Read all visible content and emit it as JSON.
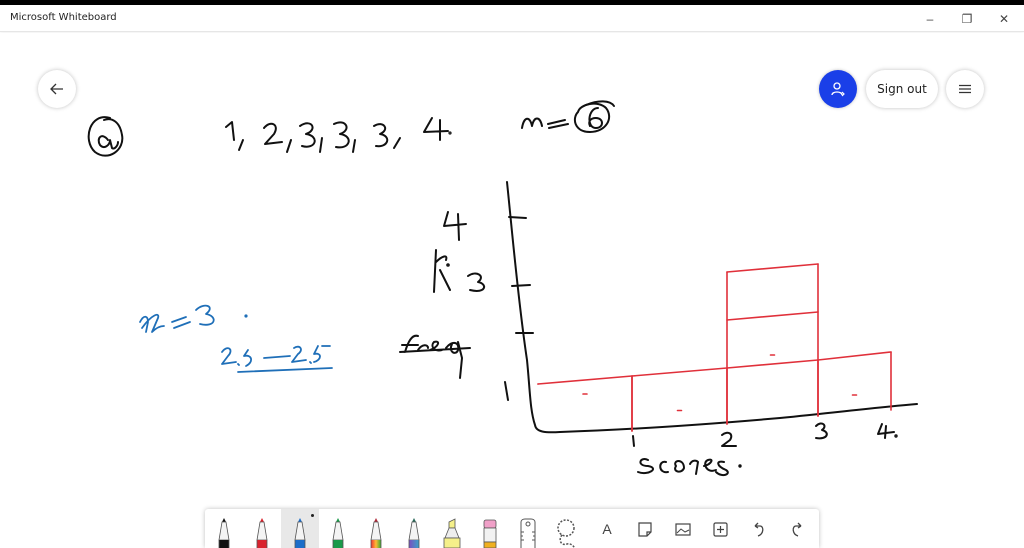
{
  "window": {
    "title": "Microsoft Whiteboard",
    "controls": {
      "minimize": "–",
      "restore": "❐",
      "close": "✕"
    }
  },
  "header": {
    "back_icon": "←",
    "share_icon": "person-add",
    "sign_out_label": "Sign out",
    "menu_icon": "≡",
    "share_color": "#1a3fe8"
  },
  "board": {
    "question_label": "(a)",
    "data_list": "1, 2, 3, 3, 3, 4.",
    "n_label": "n = 6",
    "side_note_1": "x = 3.",
    "side_note_2": "2.5 — 2.5",
    "y_axis_label": "freq / fi",
    "x_axis_label": "scores.",
    "y_ticks": [
      "1",
      "3",
      "4"
    ],
    "x_ticks": [
      "1",
      "2",
      "3",
      "4."
    ],
    "ink_colors": {
      "black": "#111111",
      "red": "#e0303a",
      "blue": "#1f6fb8"
    }
  },
  "chart_data": {
    "type": "bar",
    "title": "",
    "xlabel": "scores.",
    "ylabel": "freq",
    "categories": [
      "1",
      "2",
      "3",
      "4"
    ],
    "values": [
      1,
      1,
      3,
      1
    ],
    "note": "hand-drawn histogram of data 1,2,3,3,3,4 (frequency per score)",
    "ylim": [
      0,
      4
    ]
  },
  "toolbar": {
    "tools": [
      {
        "name": "pen-black",
        "color": "#111111"
      },
      {
        "name": "pen-red",
        "color": "#d9232e"
      },
      {
        "name": "pen-blue",
        "color": "#1c6dc9",
        "selected": true
      },
      {
        "name": "pen-green",
        "color": "#1a9a4a"
      },
      {
        "name": "pen-rainbow",
        "color": "#e0552a"
      },
      {
        "name": "pen-galaxy",
        "color": "#6a5acd"
      },
      {
        "name": "highlighter",
        "color": "#f5f08a"
      },
      {
        "name": "eraser",
        "color": "#f0a0c8"
      },
      {
        "name": "ruler",
        "color": "#555555"
      },
      {
        "name": "lasso",
        "color": "#555555"
      }
    ],
    "text_tool_label": "A",
    "note_icon": "▭",
    "image_icon": "▣",
    "insert_icon": "⊞",
    "undo_icon": "↶",
    "redo_icon": "↷"
  }
}
